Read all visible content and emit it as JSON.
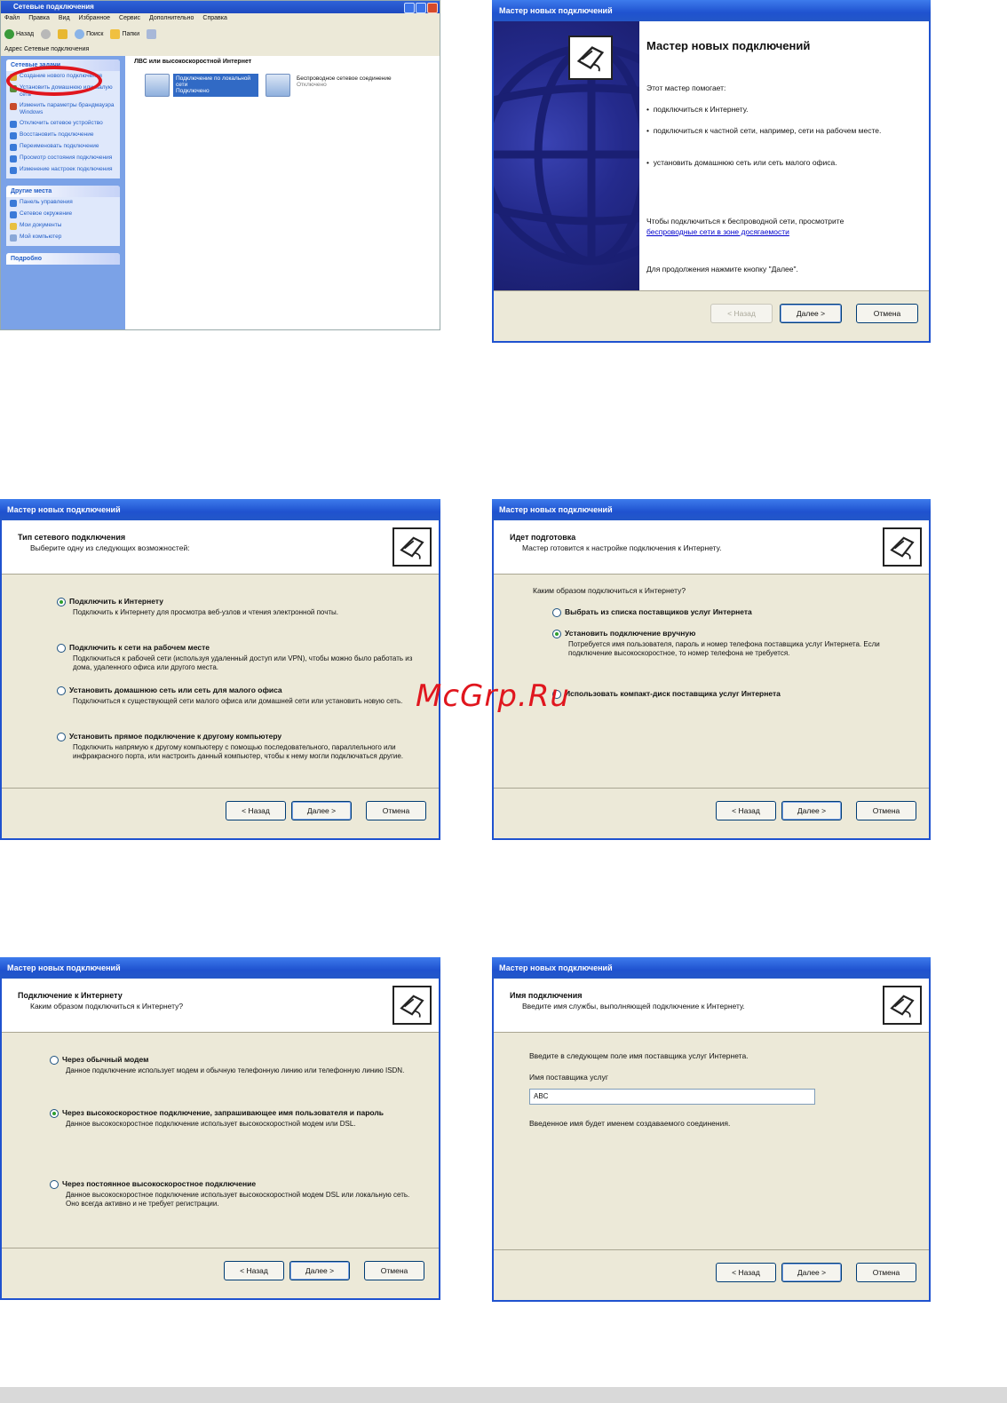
{
  "explorer": {
    "title": "Сетевые подключения",
    "menu": [
      "Файл",
      "Правка",
      "Вид",
      "Избранное",
      "Сервис",
      "Дополнительно",
      "Справка"
    ],
    "toolbar": {
      "back": "Назад",
      "search": "Поиск",
      "folders": "Папки"
    },
    "address": "Адрес  Сетевые подключения",
    "network_tasks": {
      "title": "Сетевые задачи",
      "items": [
        "Создание нового подключения",
        "Установить домашнюю или малую сеть",
        "Изменить параметры брандмауэра Windows",
        "Отключить сетевое устройство",
        "Восстановить подключение",
        "Переименовать подключение",
        "Просмотр состояния подключения",
        "Изменение настроек подключения"
      ]
    },
    "other_places": {
      "title": "Другие места",
      "items": [
        "Панель управления",
        "Сетевое окружение",
        "Мои документы",
        "Мой компьютер"
      ]
    },
    "details": {
      "title": "Подробно"
    },
    "group_header": "ЛВС или высокоскоростной Интернет",
    "connections": [
      {
        "name": "Подключение по локальной сети",
        "status": "Подключено"
      },
      {
        "name": "Беспроводное сетевое соединение",
        "status": "Отключено"
      }
    ]
  },
  "wizard_title": "Мастер новых подключений",
  "buttons": {
    "back": "< Назад",
    "next": "Далее >",
    "cancel": "Отмена"
  },
  "welcome": {
    "title": "Мастер новых подключений",
    "intro": "Этот мастер помогает:",
    "bullets": [
      "подключиться к Интернету.",
      "подключиться к частной сети, например, сети на рабочем месте.",
      "установить домашнюю сеть или сеть малого офиса."
    ],
    "note": "Чтобы подключиться к беспроводной сети, просмотрите",
    "link": "беспроводные сети в зоне досягаемости",
    "continue": "Для продолжения нажмите кнопку \"Далее\"."
  },
  "type_page": {
    "title": "Тип сетевого подключения",
    "subtitle": "Выберите одну из следующих возможностей:",
    "options": [
      {
        "label": "Подключить к Интернету",
        "desc": "Подключить к Интернету для просмотра веб-узлов и чтения электронной почты.",
        "selected": true
      },
      {
        "label": "Подключить к сети на рабочем месте",
        "desc": "Подключиться к рабочей сети (используя удаленный доступ или VPN), чтобы можно было работать из дома, удаленного офиса или другого места.",
        "selected": false
      },
      {
        "label": "Установить домашнюю сеть или сеть для малого офиса",
        "desc": "Подключиться к существующей сети малого офиса или домашней сети или установить новую сеть.",
        "selected": false
      },
      {
        "label": "Установить прямое подключение к другому компьютеру",
        "desc": "Подключить напрямую к другому компьютеру с помощью последовательного, параллельного или инфракрасного порта, или настроить данный компьютер, чтобы к нему могли подключаться другие.",
        "selected": false
      }
    ]
  },
  "ready_page": {
    "title": "Идет подготовка",
    "subtitle": "Мастер готовится к настройке подключения к Интернету.",
    "question": "Каким образом подключиться к Интернету?",
    "options": [
      {
        "label": "Выбрать из списка поставщиков услуг Интернета",
        "desc": "",
        "selected": false
      },
      {
        "label": "Установить подключение вручную",
        "desc": "Потребуется имя пользователя, пароль и номер телефона поставщика услуг Интернета. Если подключение высокоскоростное, то номер телефона не требуется.",
        "selected": true
      },
      {
        "label": "Использовать компакт-диск поставщика услуг Интернета",
        "desc": "",
        "selected": false
      }
    ]
  },
  "internet_page": {
    "title": "Подключение к Интернету",
    "subtitle": "Каким образом подключиться к Интернету?",
    "options": [
      {
        "label": "Через обычный модем",
        "desc": "Данное подключение использует модем и обычную телефонную линию или телефонную линию ISDN.",
        "selected": false
      },
      {
        "label": "Через высокоскоростное подключение, запрашивающее имя пользователя и пароль",
        "desc": "Данное высокоскоростное подключение использует высокоскоростной модем или DSL.",
        "selected": true
      },
      {
        "label": "Через постоянное высокоскоростное подключение",
        "desc": "Данное высокоскоростное подключение использует высокоскоростной модем DSL или локальную сеть. Оно всегда активно и не требует регистрации.",
        "selected": false
      }
    ]
  },
  "name_page": {
    "title": "Имя подключения",
    "subtitle": "Введите имя службы, выполняющей подключение к Интернету.",
    "prompt": "Введите в следующем поле имя поставщика услуг Интернета.",
    "field_label": "Имя поставщика услуг",
    "field_value": "ABC",
    "hint": "Введенное имя будет именем создаваемого соединения."
  },
  "watermark": "McGrp.Ru",
  "colors": {
    "xp_blue": "#1f52cf",
    "dialog_bg": "#ece9d8",
    "highlight": "#e0161e"
  }
}
